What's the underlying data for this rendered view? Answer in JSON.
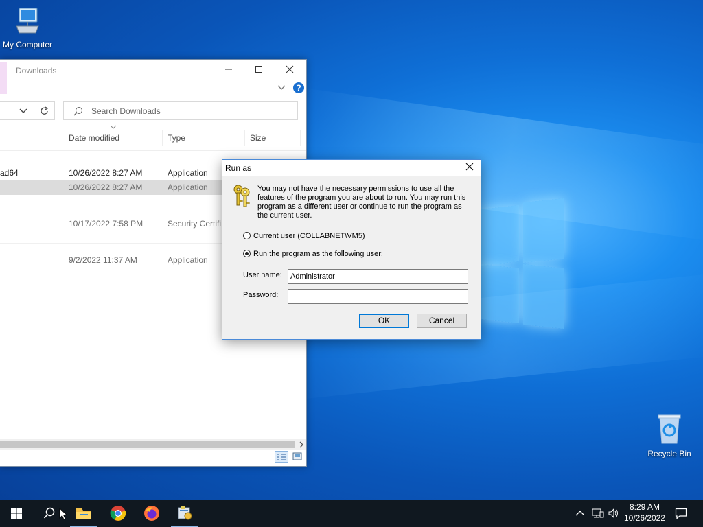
{
  "desktop": {
    "icons": [
      {
        "label": "My Computer"
      },
      {
        "label": "Recycle Bin"
      }
    ]
  },
  "explorer": {
    "title": "Downloads",
    "search_placeholder": "Search Downloads",
    "columns": [
      "Date modified",
      "Type",
      "Size"
    ],
    "rows": [
      {
        "name": "ad64",
        "date": "10/26/2022 8:27 AM",
        "type": "Application",
        "selected": false
      },
      {
        "name": "",
        "date": "10/26/2022 8:27 AM",
        "type": "Application",
        "selected": true
      },
      {
        "name": "",
        "date": "10/17/2022 7:58 PM",
        "type": "Security Certifi",
        "selected": false
      },
      {
        "name": "",
        "date": "9/2/2022 11:37 AM",
        "type": "Application",
        "selected": false
      }
    ]
  },
  "dialog": {
    "title": "Run as",
    "message": "You may not have the necessary permissions to use all the features of the program you are about to run. You may run this program as a different user or continue to run the program as the current user.",
    "option_current": "Current user (COLLABNET\\VM5)",
    "option_other": "Run the program as the following user:",
    "username_label": "User name:",
    "username_value": "Administrator",
    "password_label": "Password:",
    "password_value": "",
    "ok_label": "OK",
    "cancel_label": "Cancel"
  },
  "taskbar": {
    "time": "8:29 AM",
    "date": "10/26/2022"
  }
}
